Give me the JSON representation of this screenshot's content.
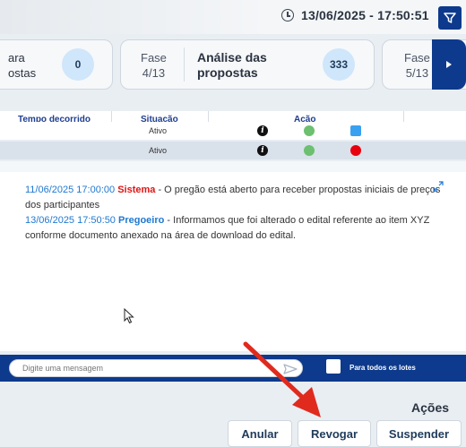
{
  "header": {
    "datetime": "13/06/2025 - 17:50:51",
    "icons": {
      "clock": "clock-icon",
      "filter": "filter-icon"
    }
  },
  "phases": [
    {
      "line1": "ara",
      "line2": "ostas",
      "count": "0"
    },
    {
      "label_line1": "Fase",
      "label_line2": "4/13",
      "name_line1": "Análise das",
      "name_line2": "propostas",
      "count": "333"
    },
    {
      "label_line1": "Fase",
      "label_line2": "5/13"
    }
  ],
  "table": {
    "headers": [
      "Tempo decorrido",
      "Situação",
      "Ação"
    ],
    "rows": [
      {
        "situacao": "Ativo"
      },
      {
        "situacao": "Ativo"
      }
    ]
  },
  "chat": {
    "messages": [
      {
        "timestamp": "11/06/2025 17:00:00",
        "author": "Sistema",
        "text": "- O pregão está aberto para receber propostas iniciais de preços dos participantes"
      },
      {
        "timestamp": "13/06/2025 17:50:50",
        "author": "Pregoeiro",
        "text": "- Informamos que foi alterado o edital referente ao item XYZ conforme documento anexado na área de download do edital."
      }
    ],
    "input_placeholder": "Digite uma mensagem",
    "all_lots_label": "Para todos os lotes"
  },
  "actions": {
    "title": "Ações",
    "buttons": [
      "Anular",
      "Revogar",
      "Suspender"
    ]
  },
  "colors": {
    "brand": "#0d3a8c",
    "accent": "#1f78d1",
    "danger": "#e8000e",
    "arrow": "#e02a1e"
  }
}
